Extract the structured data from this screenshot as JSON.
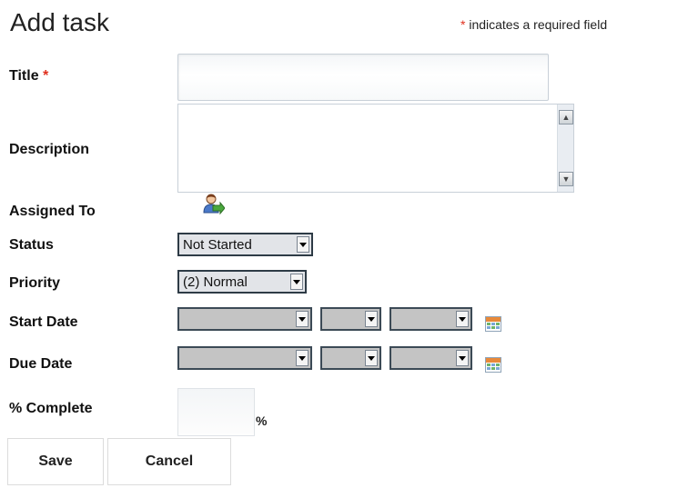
{
  "page": {
    "title": "Add task"
  },
  "required_note": {
    "star": "*",
    "text": " indicates a required field"
  },
  "fields": {
    "title": {
      "label": "Title",
      "required_star": "*",
      "value": ""
    },
    "description": {
      "label": "Description",
      "value": ""
    },
    "assigned_to": {
      "label": "Assigned To",
      "icon": "user-picker-icon"
    },
    "status": {
      "label": "Status",
      "selected": "Not Started"
    },
    "priority": {
      "label": "Priority",
      "selected": "(2) Normal"
    },
    "start_date": {
      "label": "Start Date",
      "month": "",
      "day": "",
      "year": "",
      "icon": "calendar-icon"
    },
    "due_date": {
      "label": "Due Date",
      "month": "",
      "day": "",
      "year": "",
      "icon": "calendar-icon"
    },
    "percent_complete": {
      "label": "% Complete",
      "value": "",
      "unit": "%"
    }
  },
  "buttons": {
    "save": "Save",
    "cancel": "Cancel"
  }
}
